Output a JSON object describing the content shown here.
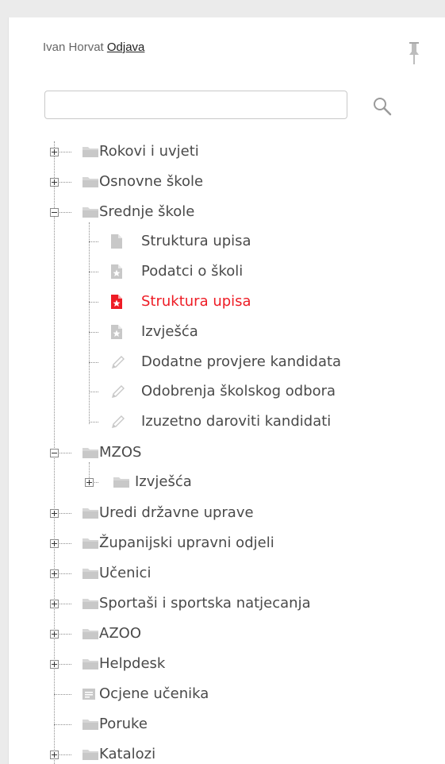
{
  "header": {
    "user_name": "Ivan Horvat",
    "logout_label": "Odjava"
  },
  "search": {
    "value": "",
    "placeholder": ""
  },
  "tree": [
    {
      "label": "Rokovi i uvjeti",
      "icon": "folder-icon",
      "expander": "plus"
    },
    {
      "label": "Osnovne škole",
      "icon": "folder-icon",
      "expander": "plus"
    },
    {
      "label": "Srednje škole",
      "icon": "folder-icon",
      "expander": "minus"
    },
    {
      "label": "Struktura upisa",
      "icon": "document-icon"
    },
    {
      "label": "Podatci o školi",
      "icon": "star-document-icon"
    },
    {
      "label": "Struktura upisa",
      "icon": "star-document-icon",
      "selected": true
    },
    {
      "label": "Izvješća",
      "icon": "star-document-icon"
    },
    {
      "label": "Dodatne provjere kandidata",
      "icon": "pencil-icon"
    },
    {
      "label": "Odobrenja školskog odbora",
      "icon": "pencil-icon"
    },
    {
      "label": "Izuzetno daroviti kandidati",
      "icon": "pencil-icon"
    },
    {
      "label": "MZOS",
      "icon": "folder-icon",
      "expander": "minus"
    },
    {
      "label": "Izvješća",
      "icon": "folder-icon",
      "expander": "plus"
    },
    {
      "label": "Uredi državne uprave",
      "icon": "folder-icon",
      "expander": "plus"
    },
    {
      "label": "Županijski upravni odjeli",
      "icon": "folder-icon",
      "expander": "plus"
    },
    {
      "label": "Učenici",
      "icon": "folder-icon",
      "expander": "plus"
    },
    {
      "label": "Sportaši i sportska natjecanja",
      "icon": "folder-icon",
      "expander": "plus"
    },
    {
      "label": "AZOO",
      "icon": "folder-icon",
      "expander": "plus"
    },
    {
      "label": "Helpdesk",
      "icon": "folder-icon",
      "expander": "plus"
    },
    {
      "label": "Ocjene učenika",
      "icon": "list-document-icon"
    },
    {
      "label": "Poruke",
      "icon": "folder-icon"
    },
    {
      "label": "Katalozi",
      "icon": "folder-icon",
      "expander": "plus"
    }
  ],
  "colors": {
    "selected_text": "#ee1c25",
    "text": "#4a4a4a",
    "icon_gray": "#c8c8c8"
  }
}
